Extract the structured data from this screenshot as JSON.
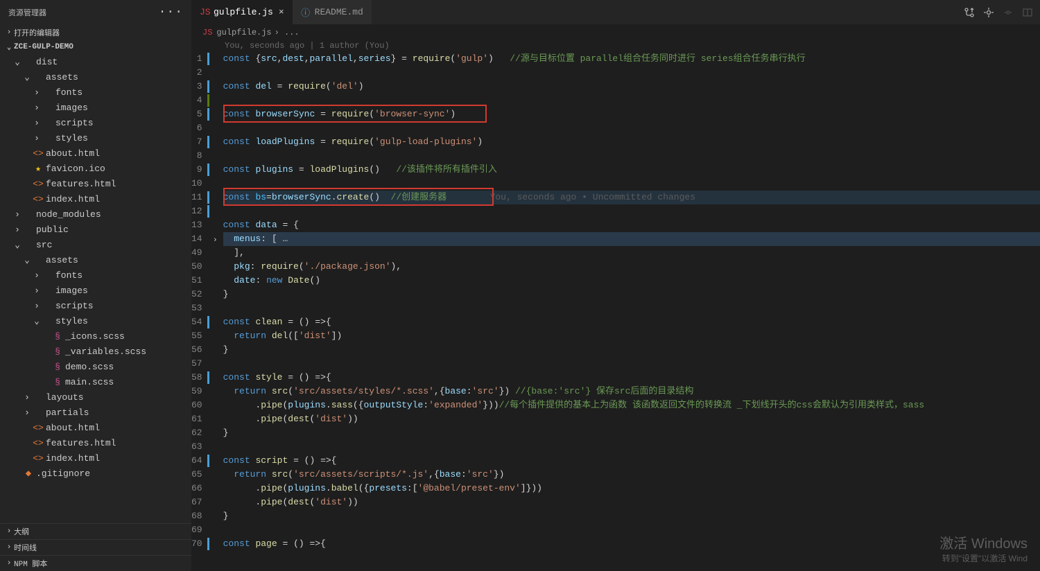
{
  "sidebar": {
    "title": "资源管理器",
    "open_editors": "打开的编辑器",
    "project": "ZCE-GULP-DEMO",
    "tree": [
      {
        "d": 1,
        "tw": "v",
        "icon": "folder",
        "label": "dist"
      },
      {
        "d": 2,
        "tw": "v",
        "icon": "folder",
        "label": "assets"
      },
      {
        "d": 3,
        "tw": ">",
        "icon": "folder",
        "label": "fonts"
      },
      {
        "d": 3,
        "tw": ">",
        "icon": "folder",
        "label": "images"
      },
      {
        "d": 3,
        "tw": ">",
        "icon": "folder",
        "label": "scripts"
      },
      {
        "d": 3,
        "tw": ">",
        "icon": "folder",
        "label": "styles"
      },
      {
        "d": 2,
        "tw": "",
        "icon": "html",
        "label": "about.html"
      },
      {
        "d": 2,
        "tw": "",
        "icon": "star",
        "label": "favicon.ico"
      },
      {
        "d": 2,
        "tw": "",
        "icon": "html",
        "label": "features.html"
      },
      {
        "d": 2,
        "tw": "",
        "icon": "html",
        "label": "index.html"
      },
      {
        "d": 1,
        "tw": ">",
        "icon": "folder",
        "label": "node_modules"
      },
      {
        "d": 1,
        "tw": ">",
        "icon": "folder",
        "label": "public"
      },
      {
        "d": 1,
        "tw": "v",
        "icon": "folder",
        "label": "src"
      },
      {
        "d": 2,
        "tw": "v",
        "icon": "folder",
        "label": "assets"
      },
      {
        "d": 3,
        "tw": ">",
        "icon": "folder",
        "label": "fonts"
      },
      {
        "d": 3,
        "tw": ">",
        "icon": "folder",
        "label": "images"
      },
      {
        "d": 3,
        "tw": ">",
        "icon": "folder",
        "label": "scripts"
      },
      {
        "d": 3,
        "tw": "v",
        "icon": "folder",
        "label": "styles"
      },
      {
        "d": 4,
        "tw": "",
        "icon": "scss",
        "label": "_icons.scss"
      },
      {
        "d": 4,
        "tw": "",
        "icon": "scss",
        "label": "_variables.scss"
      },
      {
        "d": 4,
        "tw": "",
        "icon": "scss",
        "label": "demo.scss"
      },
      {
        "d": 4,
        "tw": "",
        "icon": "scss",
        "label": "main.scss"
      },
      {
        "d": 2,
        "tw": ">",
        "icon": "folder",
        "label": "layouts"
      },
      {
        "d": 2,
        "tw": ">",
        "icon": "folder",
        "label": "partials"
      },
      {
        "d": 2,
        "tw": "",
        "icon": "html",
        "label": "about.html"
      },
      {
        "d": 2,
        "tw": "",
        "icon": "html",
        "label": "features.html"
      },
      {
        "d": 2,
        "tw": "",
        "icon": "html",
        "label": "index.html"
      },
      {
        "d": 1,
        "tw": "",
        "icon": "git",
        "label": ".gitignore"
      }
    ],
    "bottom": [
      "大纲",
      "时间线",
      "NPM 脚本"
    ]
  },
  "tabs": [
    {
      "label": "gulpfile.js",
      "active": true,
      "icon": "js",
      "close": "×"
    },
    {
      "label": "README.md",
      "active": false,
      "icon": "info",
      "close": ""
    }
  ],
  "breadcrumb": {
    "file": "gulpfile.js",
    "sep": "› ..."
  },
  "blame_top": "You, seconds ago | 1 author (You)",
  "blame_inline": "You, seconds ago • Uncommitted changes",
  "code_lines": [
    {
      "n": 1,
      "m": "mod"
    },
    {
      "n": 2
    },
    {
      "n": 3,
      "m": "mod"
    },
    {
      "n": 4,
      "m": "add"
    },
    {
      "n": 5,
      "m": "mod"
    },
    {
      "n": 6
    },
    {
      "n": 7,
      "m": "mod"
    },
    {
      "n": 8
    },
    {
      "n": 9,
      "m": "mod"
    },
    {
      "n": 10
    },
    {
      "n": 11,
      "m": "mod"
    },
    {
      "n": 12,
      "m": "mod"
    },
    {
      "n": 13
    },
    {
      "n": 14,
      "fold": true
    },
    {
      "n": 49
    },
    {
      "n": 50
    },
    {
      "n": 51
    },
    {
      "n": 52
    },
    {
      "n": 53
    },
    {
      "n": 54,
      "m": "mod"
    },
    {
      "n": 55
    },
    {
      "n": 56
    },
    {
      "n": 57
    },
    {
      "n": 58,
      "m": "mod"
    },
    {
      "n": 59
    },
    {
      "n": 60
    },
    {
      "n": 61
    },
    {
      "n": 62
    },
    {
      "n": 63
    },
    {
      "n": 64,
      "m": "mod"
    },
    {
      "n": 65
    },
    {
      "n": 66
    },
    {
      "n": 67
    },
    {
      "n": 68
    },
    {
      "n": 69
    },
    {
      "n": 70,
      "m": "mod"
    }
  ],
  "watermark": {
    "l1": "激活 Windows",
    "l2": "转到\"设置\"以激活 Wind"
  }
}
